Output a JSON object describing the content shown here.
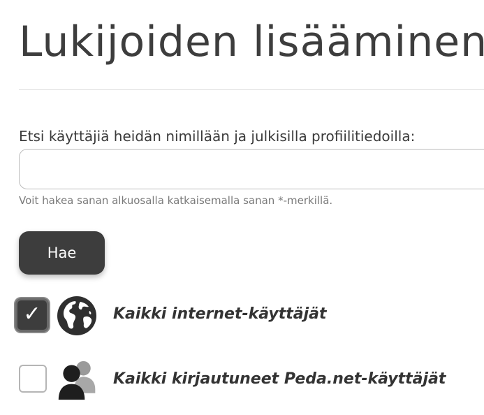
{
  "page": {
    "title": "Lukijoiden lisääminen"
  },
  "search": {
    "label": "Etsi käyttäjiä heidän nimillään ja julkisilla profiilitiedoilla:",
    "value": "",
    "placeholder": "",
    "hint": "Voit hakea sanan alkuosalla katkaisemalla sanan *-merkillä.",
    "button_label": "Hae"
  },
  "options": [
    {
      "label": "Kaikki internet-käyttäjät",
      "checked": true,
      "checkmark": "✓",
      "icon": "globe-icon"
    },
    {
      "label": "Kaikki kirjautuneet Peda.net-käyttäjät",
      "checked": false,
      "icon": "users-icon"
    }
  ],
  "colors": {
    "text": "#3a3a3a",
    "button_bg": "#3d3d3d",
    "button_text": "#ffffff",
    "hint": "#7a7a7a",
    "divider": "#dedede",
    "input_border": "#bdbdbd"
  }
}
